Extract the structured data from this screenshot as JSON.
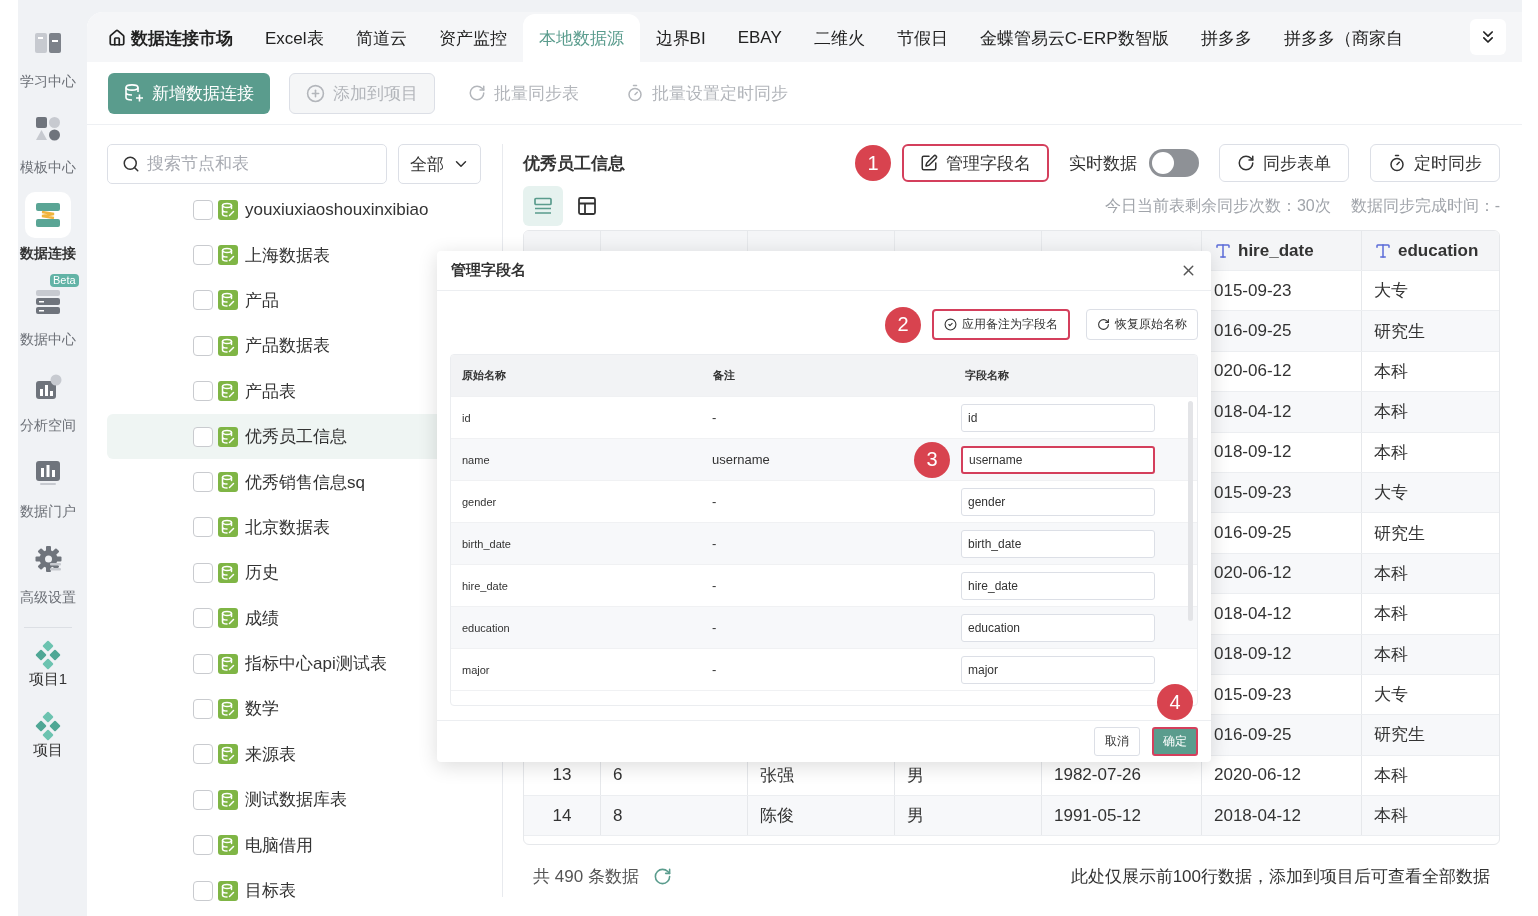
{
  "nav": {
    "items": [
      {
        "label": "学习中心",
        "selected": false
      },
      {
        "label": "模板中心",
        "selected": false
      },
      {
        "label": "数据连接",
        "selected": true
      },
      {
        "label": "数据中心",
        "selected": false,
        "badge": "Beta"
      },
      {
        "label": "分析空间",
        "selected": false
      },
      {
        "label": "数据门户",
        "selected": false
      },
      {
        "label": "高级设置",
        "selected": false
      }
    ],
    "projects": [
      {
        "label": "项目1"
      },
      {
        "label": "项目"
      }
    ]
  },
  "tabs": [
    {
      "label": "数据连接市场",
      "kind": "home",
      "selected": false
    },
    {
      "label": "Excel表",
      "kind": "source",
      "selected": false
    },
    {
      "label": "简道云",
      "kind": "source",
      "selected": false
    },
    {
      "label": "资产监控",
      "kind": "source",
      "selected": false
    },
    {
      "label": "本地数据源",
      "kind": "source",
      "selected": true
    },
    {
      "label": "边界BI",
      "kind": "source",
      "selected": false
    },
    {
      "label": "EBAY",
      "kind": "source",
      "selected": false
    },
    {
      "label": "二维火",
      "kind": "source",
      "selected": false
    },
    {
      "label": "节假日",
      "kind": "source",
      "selected": false
    },
    {
      "label": "金蝶管易云C-ERP数智版",
      "kind": "source",
      "selected": false
    },
    {
      "label": "拼多多",
      "kind": "source",
      "selected": false
    },
    {
      "label": "拼多多（商家自",
      "kind": "source",
      "selected": false
    }
  ],
  "toolbar": [
    {
      "label": "新增数据连接",
      "kind": "primary",
      "disabled": false
    },
    {
      "label": "添加到项目",
      "kind": "default",
      "disabled": true
    },
    {
      "label": "批量同步表",
      "kind": "text",
      "disabled": true
    },
    {
      "label": "批量设置定时同步",
      "kind": "text",
      "disabled": true
    }
  ],
  "tree": {
    "search": {
      "placeholder": "搜索节点和表"
    },
    "filter": {
      "value": "全部"
    },
    "items": [
      {
        "label": "youxiuxiaoshouxinxibiao",
        "checked": false,
        "selected": false
      },
      {
        "label": "上海数据表",
        "checked": false,
        "selected": false
      },
      {
        "label": "产品",
        "checked": false,
        "selected": false
      },
      {
        "label": "产品数据表",
        "checked": false,
        "selected": false
      },
      {
        "label": "产品表",
        "checked": false,
        "selected": false
      },
      {
        "label": "优秀员工信息",
        "checked": false,
        "selected": true
      },
      {
        "label": "优秀销售信息sq",
        "checked": false,
        "selected": false
      },
      {
        "label": "北京数据表",
        "checked": false,
        "selected": false
      },
      {
        "label": "历史",
        "checked": false,
        "selected": false
      },
      {
        "label": "成绩",
        "checked": false,
        "selected": false
      },
      {
        "label": "指标中心api测试表",
        "checked": false,
        "selected": false
      },
      {
        "label": "数学",
        "checked": false,
        "selected": false
      },
      {
        "label": "来源表",
        "checked": false,
        "selected": false
      },
      {
        "label": "测试数据库表",
        "checked": false,
        "selected": false
      },
      {
        "label": "电脑借用",
        "checked": false,
        "selected": false
      },
      {
        "label": "目标表",
        "checked": false,
        "selected": false
      }
    ]
  },
  "detail": {
    "title": "优秀员工信息",
    "manage": {
      "label": "管理字段名",
      "highlighted": true,
      "callout": "1"
    },
    "realtime": {
      "label": "实时数据",
      "on": false
    },
    "sync": {
      "label": "同步表单"
    },
    "schedule": {
      "label": "定时同步"
    },
    "views": [
      {
        "kind": "list",
        "selected": true
      },
      {
        "kind": "grid",
        "selected": false
      }
    ],
    "sync_info": [
      "今日当前表剩余同步次数：30次",
      "数据同步完成时间：-"
    ],
    "table": {
      "columns": [
        "hire_date",
        "education"
      ],
      "rows": [
        {
          "cells": [
            "015-09-23",
            "大专"
          ]
        },
        {
          "cells": [
            "016-09-25",
            "研究生"
          ]
        },
        {
          "cells": [
            "020-06-12",
            "本科"
          ]
        },
        {
          "cells": [
            "018-04-12",
            "本科"
          ]
        },
        {
          "cells": [
            "018-09-12",
            "本科"
          ]
        },
        {
          "cells": [
            "015-09-23",
            "大专"
          ]
        },
        {
          "cells": [
            "016-09-25",
            "研究生"
          ]
        },
        {
          "cells": [
            "020-06-12",
            "本科"
          ]
        },
        {
          "cells": [
            "018-04-12",
            "本科"
          ]
        },
        {
          "cells": [
            "018-09-12",
            "本科"
          ]
        },
        {
          "cells": [
            "015-09-23",
            "大专"
          ]
        },
        {
          "cells": [
            "016-09-25",
            "研究生"
          ]
        },
        {
          "cells": [
            "13",
            "6",
            "张强",
            "男",
            "1982-07-26",
            "2020-06-12",
            "本科"
          ]
        },
        {
          "cells": [
            "14",
            "8",
            "陈俊",
            "男",
            "1991-05-12",
            "2018-04-12",
            "本科"
          ]
        }
      ]
    },
    "footer": {
      "count": "共 490 条数据",
      "note": "此处仅展示前100行数据，添加到项目后可查看全部数据"
    }
  },
  "dialog": {
    "title": "管理字段名",
    "actions": [
      {
        "label": "应用备注为字段名",
        "highlighted": true,
        "callout": "2"
      },
      {
        "label": "恢复原始名称",
        "highlighted": false
      }
    ],
    "columns": [
      "原始名称",
      "备注",
      "字段名称"
    ],
    "rows": [
      {
        "original": "id",
        "note": "-",
        "field": "id",
        "highlighted": false
      },
      {
        "original": "name",
        "note": "username",
        "field": "username",
        "highlighted": true,
        "callout": "3"
      },
      {
        "original": "gender",
        "note": "-",
        "field": "gender",
        "highlighted": false
      },
      {
        "original": "birth_date",
        "note": "-",
        "field": "birth_date",
        "highlighted": false
      },
      {
        "original": "hire_date",
        "note": "-",
        "field": "hire_date",
        "highlighted": false
      },
      {
        "original": "education",
        "note": "-",
        "field": "education",
        "highlighted": false
      },
      {
        "original": "major",
        "note": "-",
        "field": "major",
        "highlighted": false
      }
    ],
    "buttons": [
      {
        "label": "取消",
        "kind": "default",
        "highlighted": false
      },
      {
        "label": "确定",
        "kind": "primary",
        "highlighted": true,
        "callout": "4"
      }
    ]
  }
}
